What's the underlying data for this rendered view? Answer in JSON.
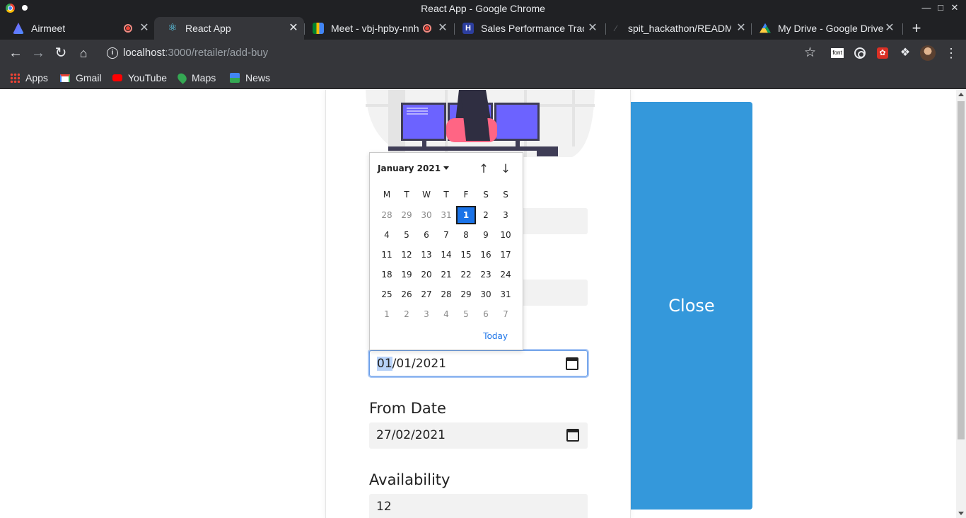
{
  "window": {
    "title": "React App - Google Chrome"
  },
  "tabs": [
    {
      "label": "Airmeet",
      "recording": true
    },
    {
      "label": "React App",
      "active": true
    },
    {
      "label": "Meet - vbj-hpby-nnh",
      "recording": true
    },
    {
      "label": "Sales Performance Track"
    },
    {
      "label": "spit_hackathon/READMI"
    },
    {
      "label": "My Drive - Google Drive"
    }
  ],
  "toolbar": {
    "url_host": "localhost",
    "url_path": ":3000/retailer/add-buy"
  },
  "extensions": {
    "font_label": "font"
  },
  "bookmarks": [
    {
      "label": "Apps",
      "icon": "apps-grid-icon"
    },
    {
      "label": "Gmail",
      "icon": "gmail-icon"
    },
    {
      "label": "YouTube",
      "icon": "youtube-icon"
    },
    {
      "label": "Maps",
      "icon": "maps-icon"
    },
    {
      "label": "News",
      "icon": "news-icon"
    }
  ],
  "close_panel": {
    "label": "Close"
  },
  "datepicker": {
    "month_label": "January 2021",
    "weekdays": [
      "M",
      "T",
      "W",
      "T",
      "F",
      "S",
      "S"
    ],
    "weeks": [
      [
        "28",
        "29",
        "30",
        "31",
        "1",
        "2",
        "3"
      ],
      [
        "4",
        "5",
        "6",
        "7",
        "8",
        "9",
        "10"
      ],
      [
        "11",
        "12",
        "13",
        "14",
        "15",
        "16",
        "17"
      ],
      [
        "18",
        "19",
        "20",
        "21",
        "22",
        "23",
        "24"
      ],
      [
        "25",
        "26",
        "27",
        "28",
        "29",
        "30",
        "31"
      ],
      [
        "1",
        "2",
        "3",
        "4",
        "5",
        "6",
        "7"
      ]
    ],
    "today_label": "Today"
  },
  "form": {
    "focused_date": {
      "seg1": "01",
      "rest": "/01/2021"
    },
    "from_date": {
      "label": "From Date",
      "value": "27/02/2021"
    },
    "availability": {
      "label": "Availability",
      "value": "12"
    }
  },
  "colors": {
    "accent": "#3498db",
    "selected_day": "#1a73e8",
    "chrome_dark": "#202124"
  }
}
